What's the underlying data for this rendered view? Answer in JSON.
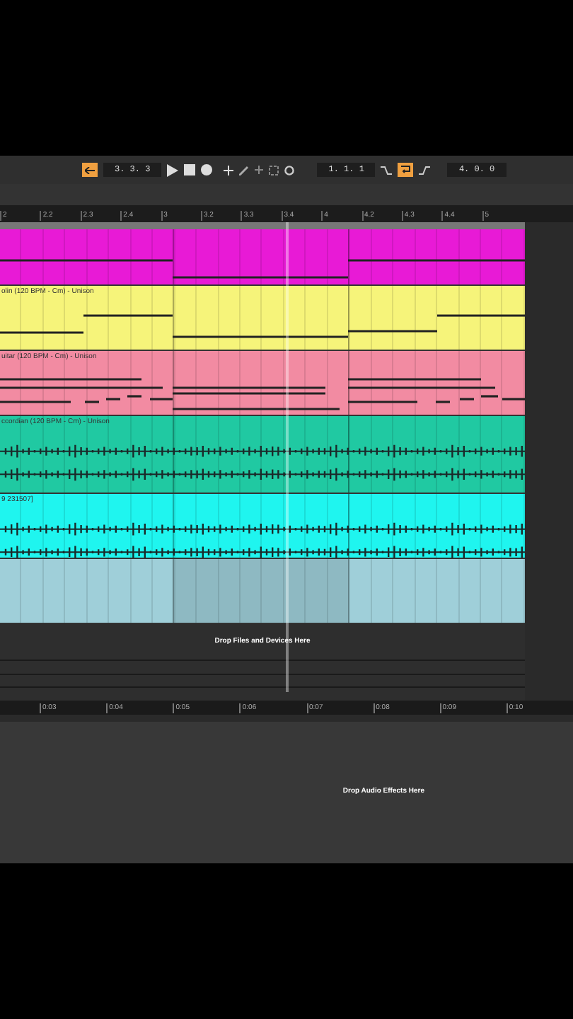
{
  "toolbar": {
    "arrangement_toggle": {
      "on": true
    },
    "song_position": "3. 3. 3",
    "loop_start": "1. 1. 1",
    "loop_switch": {
      "on": true
    },
    "loop_length": "4. 0. 0"
  },
  "ruler": {
    "bars": [
      "2",
      "2.2",
      "2.3",
      "2.4",
      "3",
      "3.2",
      "3.3",
      "3.4",
      "4",
      "4.2",
      "4.3",
      "4.4",
      "5"
    ]
  },
  "tracks": [
    {
      "kind": "midi",
      "color": "#e81ad6"
    },
    {
      "kind": "midi",
      "color": "#f6f47a",
      "label": "olin (120 BPM - Cm) - Unison"
    },
    {
      "kind": "midi",
      "color": "#f28ba2",
      "label": "uitar (120 BPM - Cm) - Unison"
    },
    {
      "kind": "audio",
      "color": "#20c9a2",
      "label": "ccordian (120 BPM - Cm) - Unison"
    },
    {
      "kind": "audio",
      "color": "#1ff5ef",
      "label": "9 231507]"
    },
    {
      "kind": "blank",
      "color": "#9fcfd9"
    }
  ],
  "drop_zone": "Drop Files and Devices Here",
  "time_ruler": [
    "0:03",
    "0:04",
    "0:05",
    "0:06",
    "0:07",
    "0:08",
    "0:09",
    "0:10"
  ],
  "device_panel": {
    "hint": "Drop Audio Effects Here"
  }
}
